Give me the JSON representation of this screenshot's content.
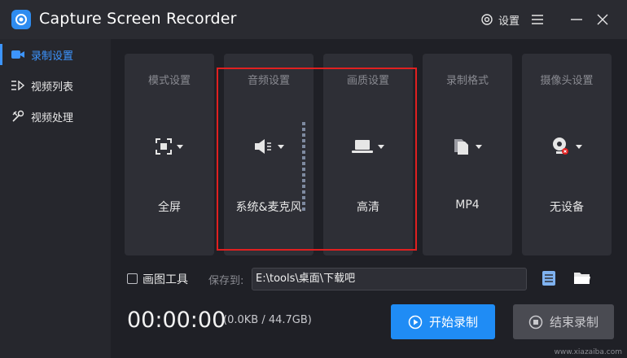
{
  "app": {
    "title": "Capture Screen Recorder",
    "settings_label": "设置",
    "accent": "#1f8cf5"
  },
  "sidebar": {
    "items": [
      {
        "label": "录制设置",
        "icon": "camera-icon",
        "active": true
      },
      {
        "label": "视频列表",
        "icon": "video-list-icon",
        "active": false
      },
      {
        "label": "视频处理",
        "icon": "tools-icon",
        "active": false
      }
    ]
  },
  "cards": [
    {
      "title": "模式设置",
      "value": "全屏",
      "icon": "fullscreen-icon"
    },
    {
      "title": "音频设置",
      "value": "系统&麦克风",
      "icon": "speaker-icon"
    },
    {
      "title": "画质设置",
      "value": "高清",
      "icon": "laptop-icon"
    },
    {
      "title": "录制格式",
      "value": "MP4",
      "icon": "file-icon"
    },
    {
      "title": "摄像头设置",
      "value": "无设备",
      "icon": "webcam-icon"
    }
  ],
  "tools": {
    "draw_tool_label": "画图工具",
    "draw_tool_checked": false,
    "save_to_label": "保存到:",
    "save_path": "E:\\tools\\桌面\\下载吧"
  },
  "status": {
    "timer": "00:00:00",
    "size": "(0.0KB / 44.7GB)"
  },
  "actions": {
    "start_label": "开始录制",
    "stop_label": "结束录制"
  },
  "watermark": "www.xiazaiba.com"
}
